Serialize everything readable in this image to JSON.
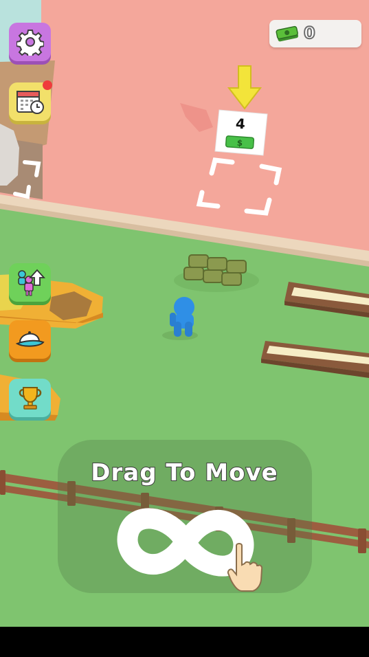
{
  "hud": {
    "cash_value": "0",
    "cash_icon": "cash-stack-icon"
  },
  "sidebar": {
    "settings_icon": "gear-icon",
    "calendar_icon": "calendar-clock-icon",
    "calendar_notification": true,
    "upgrade_staff_icon": "worker-upgrade-icon",
    "cap_icon": "cap-icon",
    "trophy_icon": "trophy-icon"
  },
  "world": {
    "build_spot_cost": "4",
    "build_spot_currency_icon": "dollar-bill-icon",
    "pointer_icon": "down-arrow-icon"
  },
  "tutorial": {
    "label": "Drag To Move",
    "gesture_icon": "infinity-drag-icon",
    "hand_icon": "pointing-hand-icon"
  },
  "colors": {
    "floor_pink": "#f4a79b",
    "grass_green": "#7fc46f",
    "player_blue": "#2f8fe6",
    "arrow_yellow": "#f3e43a",
    "settings_purple": "#c876e0",
    "calendar_yellow": "#f2e06a",
    "upgrade_green": "#6fd15a",
    "cap_orange": "#f29a1f",
    "trophy_teal": "#72dcc9"
  }
}
